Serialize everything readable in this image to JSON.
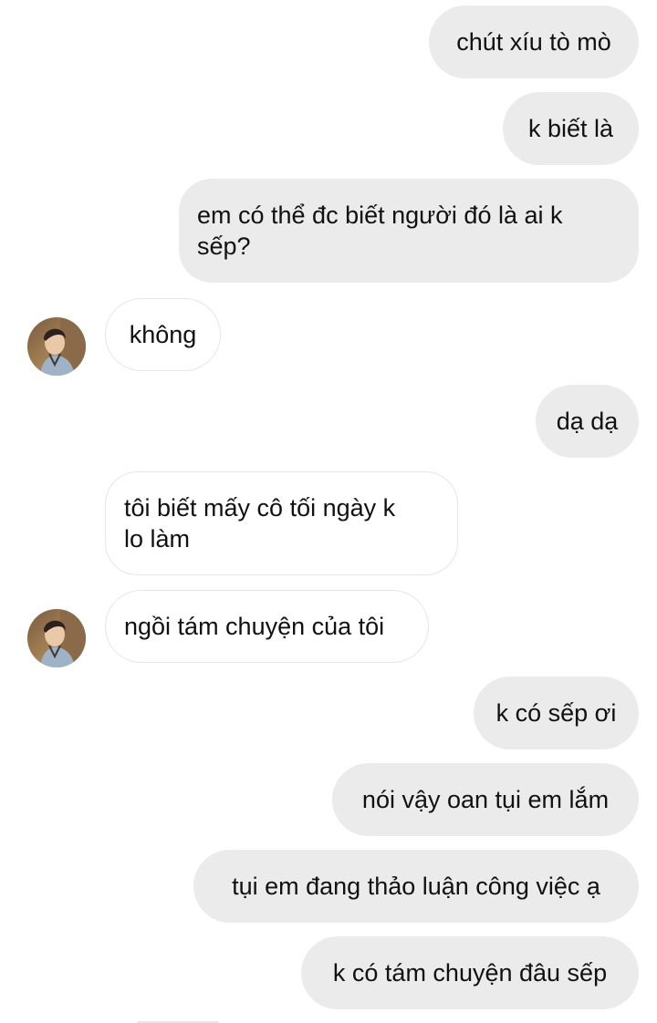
{
  "conversation": {
    "messages": [
      {
        "direction": "outgoing",
        "text": "chút xíu tò mò"
      },
      {
        "direction": "outgoing",
        "text": "k biết là"
      },
      {
        "direction": "outgoing",
        "text": "em có thể đc biết người đó là ai k\nsếp?"
      },
      {
        "direction": "incoming",
        "text": "không",
        "avatar": true
      },
      {
        "direction": "outgoing",
        "text": "dạ dạ"
      },
      {
        "direction": "incoming",
        "text": "tôi biết mấy cô tối ngày k\nlo làm"
      },
      {
        "direction": "incoming",
        "text": "ngồi tám chuyện của tôi",
        "avatar": true
      },
      {
        "direction": "outgoing",
        "text": "k có sếp ơi"
      },
      {
        "direction": "outgoing",
        "text": "nói vậy oan tụi em lắm"
      },
      {
        "direction": "outgoing",
        "text": "tụi em đang thảo luận công việc ạ"
      },
      {
        "direction": "outgoing",
        "text": "k có tám chuyện đâu sếp"
      }
    ]
  },
  "theme": {
    "outgoing_bubble": "#ebebeb",
    "incoming_bubble": "#ffffff",
    "incoming_border": "#e6e6e6",
    "text": "#111111"
  },
  "avatar": {
    "icon": "user-avatar-photo"
  }
}
